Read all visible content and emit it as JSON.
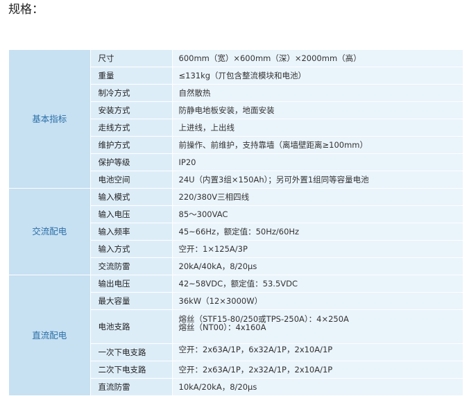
{
  "heading": "规格：",
  "sections": [
    {
      "category": "基本指标",
      "rows": [
        {
          "name": "尺寸",
          "value": "600mm（宽）×600mm（深）×2000mm（高）"
        },
        {
          "name": "重量",
          "value": "≤131kg（丌包含整流模块和电池）"
        },
        {
          "name": "制冷方式",
          "value": "自然散热"
        },
        {
          "name": "安装方式",
          "value": "防静电地板安装，地面安装"
        },
        {
          "name": "走线方式",
          "value": "上进线，上出线"
        },
        {
          "name": "维护方式",
          "value": "前操作、前维护，支持靠墙（离墙壁距离≥100mm）"
        },
        {
          "name": "保护等级",
          "value": "IP20"
        },
        {
          "name": "电池空间",
          "value": "24U（内置3组×150Ah）；另可外置1组同等容量电池"
        }
      ]
    },
    {
      "category": "交流配电",
      "rows": [
        {
          "name": "输入模式",
          "value": "220/380V三相四线"
        },
        {
          "name": "输入电压",
          "value": "85～300VAC"
        },
        {
          "name": "输入频率",
          "value": "45~66Hz，额定值：50Hz/60Hz"
        },
        {
          "name": "输入方式",
          "value": "空开：1×125A/3P"
        },
        {
          "name": "交流防雷",
          "value": "20kA/40kA，8/20μs"
        }
      ]
    },
    {
      "category": "直流配电",
      "rows": [
        {
          "name": "输出电压",
          "value": "42~58VDC，额定值：53.5VDC"
        },
        {
          "name": "最大容量",
          "value": "36kW（12×3000W）"
        },
        {
          "name": "电池支路",
          "value": "熔丝（STF15-80/250或TPS-250A）：4×250A",
          "value2": "熔丝（NT00）：4x160A"
        },
        {
          "name": "一次下电支路",
          "value": "空开：2x63A/1P，6x32A/1P，2x10A/1P"
        },
        {
          "name": "二次下电支路",
          "value": "空开：2x63A/1P，2x32A/1P，2x10A/1P"
        },
        {
          "name": "直流防雷",
          "value": "10kA/20kA，8/20μs"
        }
      ]
    }
  ]
}
